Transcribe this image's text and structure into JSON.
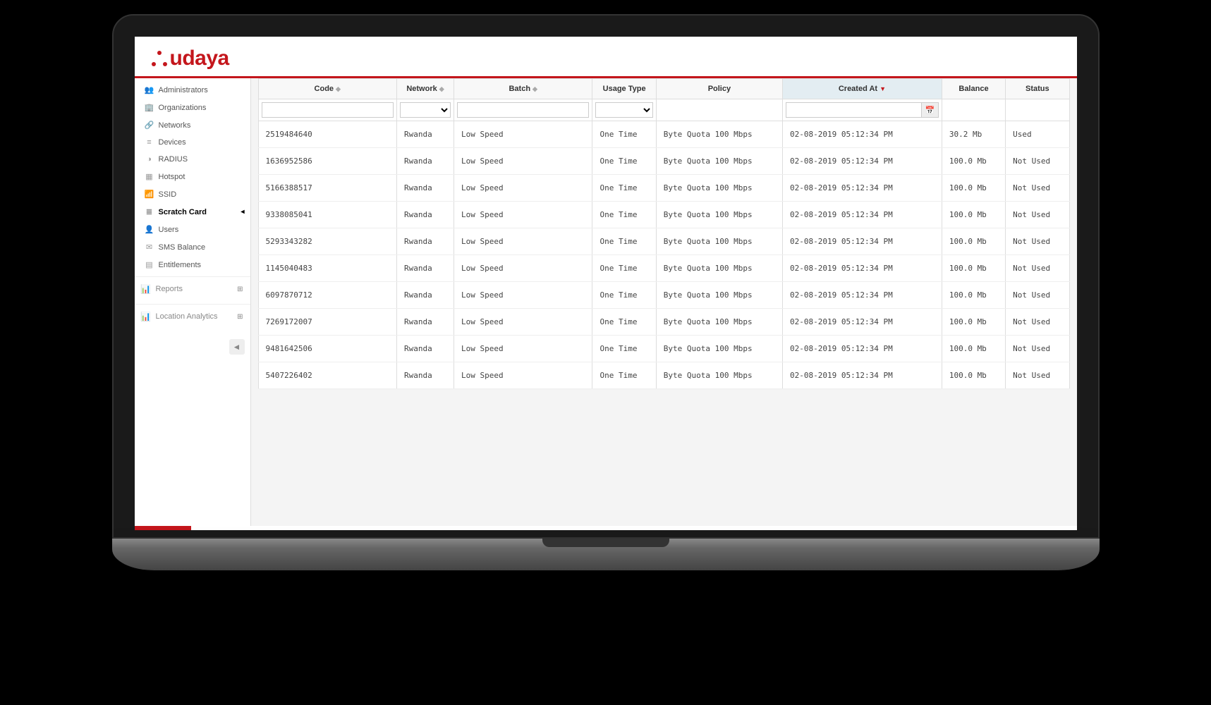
{
  "brand": {
    "name": "udaya"
  },
  "sidebar": {
    "items": [
      {
        "label": "Administrators",
        "icon": "👥"
      },
      {
        "label": "Organizations",
        "icon": "🏢"
      },
      {
        "label": "Networks",
        "icon": "🔗"
      },
      {
        "label": "Devices",
        "icon": "≡"
      },
      {
        "label": "RADIUS",
        "icon": "◑"
      },
      {
        "label": "Hotspot",
        "icon": "▦"
      },
      {
        "label": "SSID",
        "icon": "📶"
      },
      {
        "label": "Scratch Card",
        "icon": "≣",
        "active": true
      },
      {
        "label": "Users",
        "icon": "👤"
      },
      {
        "label": "SMS Balance",
        "icon": "✉"
      },
      {
        "label": "Entitlements",
        "icon": "▤"
      }
    ],
    "sections": [
      {
        "label": "Reports",
        "icon": "📊"
      },
      {
        "label": "Location Analytics",
        "icon": "📊"
      }
    ]
  },
  "table": {
    "columns": [
      {
        "label": "Code",
        "sortable": true
      },
      {
        "label": "Network",
        "sortable": true
      },
      {
        "label": "Batch",
        "sortable": true
      },
      {
        "label": "Usage Type"
      },
      {
        "label": "Policy"
      },
      {
        "label": "Created At",
        "sortable": true,
        "sorted": "desc"
      },
      {
        "label": "Balance"
      },
      {
        "label": "Status"
      }
    ],
    "filters": {
      "code": "",
      "network": "",
      "batch": "",
      "usage": "",
      "created": ""
    },
    "rows": [
      {
        "code": "2519484640",
        "network": "Rwanda",
        "batch": "Low Speed",
        "usage": "One Time",
        "policy": "Byte Quota 100 Mbps",
        "created": "02-08-2019 05:12:34 PM",
        "balance": "30.2 Mb",
        "status": "Used"
      },
      {
        "code": "1636952586",
        "network": "Rwanda",
        "batch": "Low Speed",
        "usage": "One Time",
        "policy": "Byte Quota 100 Mbps",
        "created": "02-08-2019 05:12:34 PM",
        "balance": "100.0 Mb",
        "status": "Not Used"
      },
      {
        "code": "5166388517",
        "network": "Rwanda",
        "batch": "Low Speed",
        "usage": "One Time",
        "policy": "Byte Quota 100 Mbps",
        "created": "02-08-2019 05:12:34 PM",
        "balance": "100.0 Mb",
        "status": "Not Used"
      },
      {
        "code": "9338085041",
        "network": "Rwanda",
        "batch": "Low Speed",
        "usage": "One Time",
        "policy": "Byte Quota 100 Mbps",
        "created": "02-08-2019 05:12:34 PM",
        "balance": "100.0 Mb",
        "status": "Not Used"
      },
      {
        "code": "5293343282",
        "network": "Rwanda",
        "batch": "Low Speed",
        "usage": "One Time",
        "policy": "Byte Quota 100 Mbps",
        "created": "02-08-2019 05:12:34 PM",
        "balance": "100.0 Mb",
        "status": "Not Used"
      },
      {
        "code": "1145040483",
        "network": "Rwanda",
        "batch": "Low Speed",
        "usage": "One Time",
        "policy": "Byte Quota 100 Mbps",
        "created": "02-08-2019 05:12:34 PM",
        "balance": "100.0 Mb",
        "status": "Not Used"
      },
      {
        "code": "6097870712",
        "network": "Rwanda",
        "batch": "Low Speed",
        "usage": "One Time",
        "policy": "Byte Quota 100 Mbps",
        "created": "02-08-2019 05:12:34 PM",
        "balance": "100.0 Mb",
        "status": "Not Used"
      },
      {
        "code": "7269172007",
        "network": "Rwanda",
        "batch": "Low Speed",
        "usage": "One Time",
        "policy": "Byte Quota 100 Mbps",
        "created": "02-08-2019 05:12:34 PM",
        "balance": "100.0 Mb",
        "status": "Not Used"
      },
      {
        "code": "9481642506",
        "network": "Rwanda",
        "batch": "Low Speed",
        "usage": "One Time",
        "policy": "Byte Quota 100 Mbps",
        "created": "02-08-2019 05:12:34 PM",
        "balance": "100.0 Mb",
        "status": "Not Used"
      },
      {
        "code": "5407226402",
        "network": "Rwanda",
        "batch": "Low Speed",
        "usage": "One Time",
        "policy": "Byte Quota 100 Mbps",
        "created": "02-08-2019 05:12:34 PM",
        "balance": "100.0 Mb",
        "status": "Not Used"
      }
    ]
  }
}
